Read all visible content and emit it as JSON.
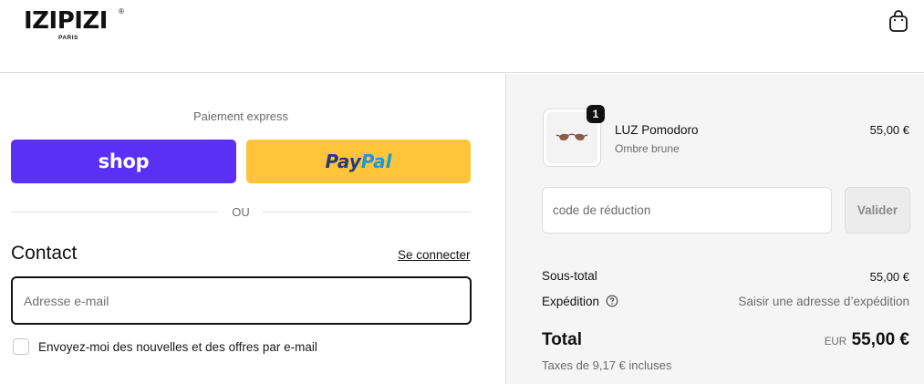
{
  "header": {
    "logo_text": "IZIPIZI",
    "logo_registered": "®",
    "logo_sub": "PARIS",
    "cart_icon": "shopping-bag-icon"
  },
  "checkout": {
    "express_label": "Paiement express",
    "shop_label": "shop",
    "paypal_part1": "Pay",
    "paypal_part2": "Pal",
    "divider_text": "OU",
    "contact_title": "Contact",
    "login_link": "Se connecter",
    "email_placeholder": "Adresse e-mail",
    "email_value": "",
    "newsletter_label": "Envoyez-moi des nouvelles et des offres par e-mail",
    "newsletter_checked": false
  },
  "summary": {
    "product": {
      "quantity": "1",
      "name": "LUZ Pomodoro",
      "variant": "Ombre brune",
      "price": "55,00 €"
    },
    "discount_placeholder": "code de réduction",
    "apply_label": "Valider",
    "subtotal_label": "Sous-total",
    "subtotal_value": "55,00 €",
    "shipping_label": "Expédition",
    "shipping_value": "Saisir une adresse d’expédition",
    "total_label": "Total",
    "total_currency": "EUR",
    "total_value": "55,00 €",
    "taxes_note": "Taxes de 9,17 € incluses"
  },
  "colors": {
    "shop_purple": "#5a31f4",
    "paypal_yellow": "#ffc439",
    "paypal_dark_blue": "#253b80",
    "paypal_light_blue": "#179bd7",
    "summary_bg": "#f5f5f5"
  }
}
